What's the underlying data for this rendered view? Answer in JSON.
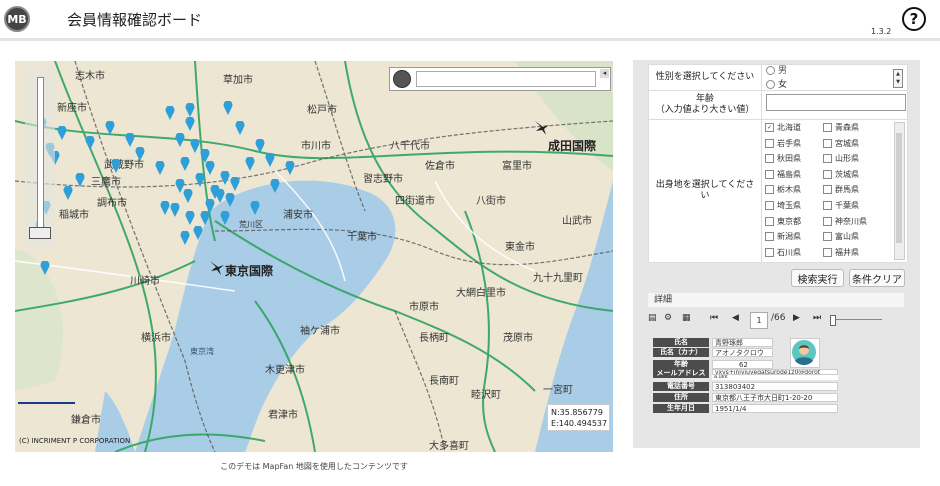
{
  "header": {
    "logo_text": "MB",
    "title": "会員情報確認ボード",
    "version": "1.3.2",
    "help_label": "?"
  },
  "map": {
    "caption": "このデモは MapFan 地図を使用したコンテンツです",
    "copyright": "(C) INCRIMENT P CORPORATION",
    "coords": {
      "lat": "N:35.856779",
      "lon": "E:140.494537"
    },
    "search_placeholder": "",
    "labels": {
      "narita": "成田国際",
      "tokyo": "東京国際",
      "tokyo_bay": "東京湾",
      "l1": "志木市",
      "l2": "草加市",
      "l3": "新座市",
      "l4": "松戸市",
      "l5": "市川市",
      "l6": "八千代市",
      "l7": "佐倉市",
      "l8": "富里市",
      "l9": "習志野市",
      "l10": "四街道市",
      "l11": "八街市",
      "l12": "千葉市",
      "l13": "山武市",
      "l14": "東金市",
      "l15": "九十九里町",
      "l16": "大網白里市",
      "l17": "市原市",
      "l18": "長柄町",
      "l19": "茂原市",
      "l20": "一宮町",
      "l21": "長南町",
      "l22": "睦沢町",
      "l23": "袖ケ浦市",
      "l24": "木更津市",
      "l25": "君津市",
      "l26": "横浜市",
      "l27": "川崎市",
      "l28": "調布市",
      "l29": "三鷹市",
      "l30": "稲城市",
      "l31": "鎌倉市",
      "l32": "大多喜町",
      "l33": "浦安市",
      "l34": "武蔵野市",
      "l35": "荒川区"
    }
  },
  "form": {
    "gender_label": "性別を選択してください",
    "gender_options": [
      "男",
      "女"
    ],
    "age_label": "年齢",
    "age_sublabel": "（入力値より大きい値）",
    "age_value": "",
    "pref_label": "出身地を選択してください",
    "prefs": [
      "北海道",
      "青森県",
      "岩手県",
      "宮城県",
      "秋田県",
      "山形県",
      "福島県",
      "茨城県",
      "栃木県",
      "群馬県",
      "埼玉県",
      "千葉県",
      "東京都",
      "神奈川県",
      "新潟県",
      "富山県",
      "石川県",
      "福井県"
    ],
    "checked": [
      "北海道"
    ]
  },
  "buttons": {
    "search": "検索実行",
    "clear": "条件クリア"
  },
  "detail": {
    "title": "詳細",
    "page_current": "1",
    "page_total": "/66",
    "fields": {
      "name_label": "氏名",
      "name_value": "青野琢郎",
      "kana_label": "氏名（カナ）",
      "kana_value": "アオノタクロウ",
      "age_label": "年齢",
      "age_value": "62",
      "email_label": "メールアドレス",
      "email_value": "yxvs+jnjyjuyeqatsurode1z0@dorot",
      "email_value2": "a.ukk",
      "phone_label": "電話番号",
      "phone_value": "313803402",
      "addr_label": "住所",
      "addr_value": "東京都八王子市大日町1-20-20",
      "birth_label": "生年月日",
      "birth_value": "1951/1/4"
    }
  },
  "colors": {
    "pin": "#2e9fd8",
    "sea": "#a9cde6",
    "land": "#ece6d3",
    "road": "#2ea35f"
  }
}
